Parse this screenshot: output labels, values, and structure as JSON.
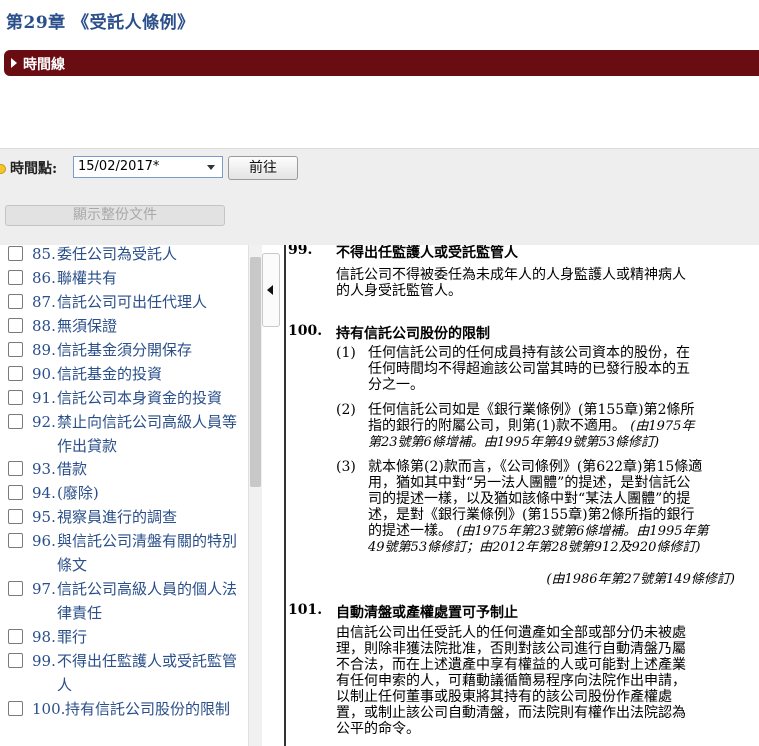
{
  "header": {
    "title": "第29章 《受託人條例》",
    "timeline_label": "時間線"
  },
  "controls": {
    "time_point_label": "時間點:",
    "date_value": "15/02/2017*",
    "go_label": "前往",
    "show_all_label": "顯示整份文件"
  },
  "toc": {
    "items": [
      {
        "num": "85.",
        "text": "委任公司為受託人"
      },
      {
        "num": "86.",
        "text": "聯權共有"
      },
      {
        "num": "87.",
        "text": "信託公司可出任代理人"
      },
      {
        "num": "88.",
        "text": "無須保證"
      },
      {
        "num": "89.",
        "text": "信託基金須分開保存"
      },
      {
        "num": "90.",
        "text": "信託基金的投資"
      },
      {
        "num": "91.",
        "text": "信託公司本身資金的投資"
      },
      {
        "num": "92.",
        "text": "禁止向信託公司高級人員等作出貸款"
      },
      {
        "num": "93.",
        "text": "借款"
      },
      {
        "num": "94.",
        "text": "(廢除)"
      },
      {
        "num": "95.",
        "text": "視察員進行的調查"
      },
      {
        "num": "96.",
        "text": "與信託公司清盤有關的特別條文"
      },
      {
        "num": "97.",
        "text": "信託公司高級人員的個人法律責任"
      },
      {
        "num": "98.",
        "text": "罪行"
      },
      {
        "num": "99.",
        "text": "不得出任監護人或受託監管人"
      },
      {
        "num": "100.",
        "text": "持有信託公司股份的限制"
      }
    ]
  },
  "content": {
    "s99": {
      "num": "99.",
      "title": "不得出任監護人或受託監管人",
      "l1": "信託公司不得被委任為未成年人的人身監護人或精神病人",
      "l2": "的人身受託監管人。"
    },
    "s100": {
      "num": "100.",
      "title": "持有信託公司股份的限制",
      "p1": {
        "num": "(1)",
        "l1": "任何信託公司的任何成員持有該公司資本的股份，在",
        "l2": "任何時間均不得超逾該公司當其時的已發行股本的五",
        "l3": "分之一。"
      },
      "p2": {
        "num": "(2)",
        "l1": "任何信託公司如是《銀行業條例》(第155章)第2條所",
        "l2": "指的銀行的附屬公司，則第(1)款不適用。",
        "l2_amend": "(由1975年",
        "l3_amend": "第23號第6條增補。由1995年第49號第53條修訂)"
      },
      "p3": {
        "num": "(3)",
        "l1": "就本條第(2)款而言，《公司條例》(第622章)第15條適",
        "l2": "用，猶如其中對“另一法人團體”的提述，是對信託公",
        "l3": "司的提述一樣，以及猶如該條中對“某法人團體”的提",
        "l4": "述，是對《銀行業條例》(第155章)第2條所指的銀行",
        "l5": "的提述一樣。",
        "l5_amend": "(由1975年第23號第6條增補。由1995年第",
        "l6_amend": "49號第53條修訂；由2012年第28號第912及920條修訂)"
      },
      "note": "(由1986年第27號第149條修訂)"
    },
    "s101": {
      "num": "101.",
      "title": "自動清盤或產權處置可予制止",
      "l1": "由信託公司出任受託人的任何遺產如全部或部分仍未被處",
      "l2": "理，則除非獲法院批准，否則對該公司進行自動清盤乃屬",
      "l3": "不合法，而在上述遺產中享有權益的人或可能對上述產業",
      "l4": "有任何申索的人，可藉動議循簡易程序向法院作出申請，",
      "l5": "以制止任何董事或股東將其持有的該公司股份作產權處",
      "l6": "置，或制止該公司自動清盤，而法院則有權作出法院認為",
      "l7": "公平的命令。"
    }
  }
}
